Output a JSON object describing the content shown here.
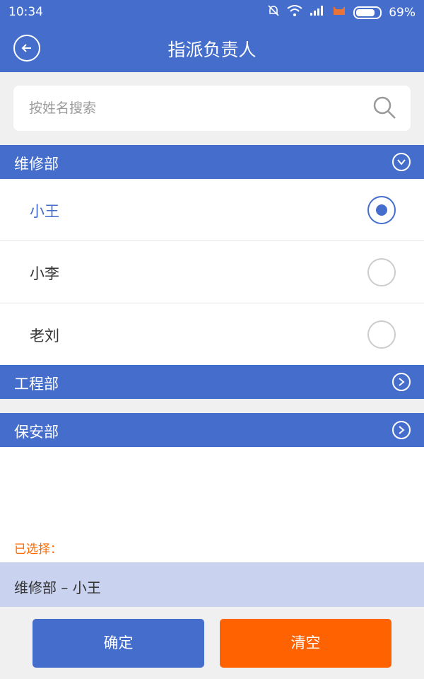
{
  "status_bar": {
    "time": "10:34",
    "battery": "69%"
  },
  "header": {
    "title": "指派负责人"
  },
  "search": {
    "placeholder": "按姓名搜索"
  },
  "departments": [
    {
      "name": "维修部",
      "expanded": true,
      "people": [
        {
          "name": "小王",
          "selected": true
        },
        {
          "name": "小李",
          "selected": false
        },
        {
          "name": "老刘",
          "selected": false
        }
      ]
    },
    {
      "name": "工程部",
      "expanded": false
    },
    {
      "name": "保安部",
      "expanded": false
    }
  ],
  "selection": {
    "label": "已选择：",
    "value": "维修部 – 小王"
  },
  "footer": {
    "confirm_label": "确定",
    "clear_label": "清空"
  },
  "colors": {
    "primary": "#456dcc",
    "accent": "#ff6200",
    "selected_bg": "#c9d3f0"
  }
}
